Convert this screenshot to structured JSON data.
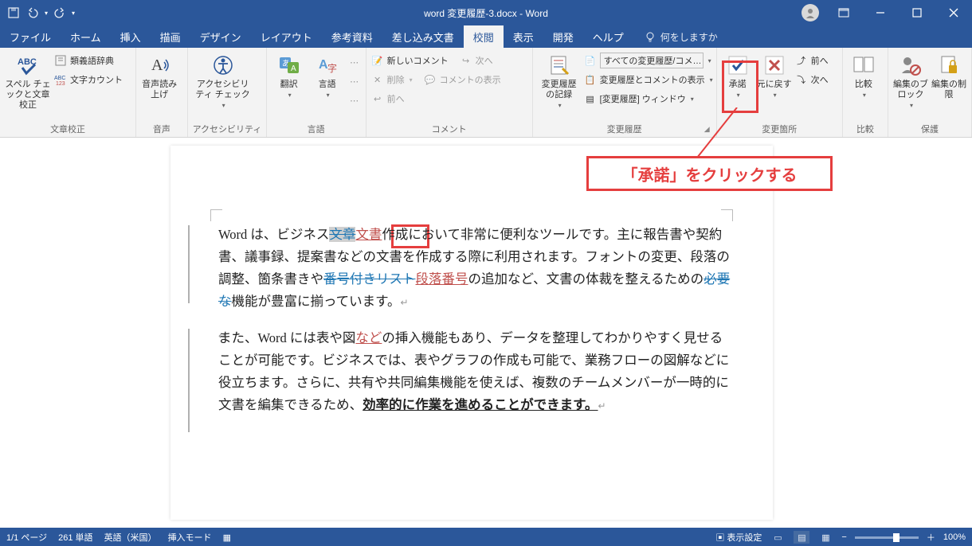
{
  "title": "word 変更履歴-3.docx  -  Word",
  "tabs": [
    "ファイル",
    "ホーム",
    "挿入",
    "描画",
    "デザイン",
    "レイアウト",
    "参考資料",
    "差し込み文書",
    "校閲",
    "表示",
    "開発",
    "ヘルプ"
  ],
  "active_tab": "校閲",
  "tell_me": "何をしますか",
  "groups": {
    "proofing": {
      "label": "文章校正",
      "spell": "スペル チェックと文章校正",
      "thesaurus": "類義語辞典",
      "wordcount": "文字カウント"
    },
    "speech": {
      "label": "音声",
      "readaloud": "音声読み上げ"
    },
    "accessibility": {
      "label": "アクセシビリティ",
      "check": "アクセシビリティ チェック"
    },
    "language": {
      "label": "言語",
      "translate": "翻訳",
      "language": "言語"
    },
    "comments": {
      "label": "コメント",
      "new": "新しいコメント",
      "delete": "削除",
      "prev": "前へ",
      "next": "次へ",
      "show": "コメントの表示"
    },
    "tracking": {
      "label": "変更履歴",
      "track": "変更履歴の記録",
      "display": "すべての変更履歴/コメ…",
      "showmarkup": "変更履歴とコメントの表示",
      "pane": "[変更履歴] ウィンドウ"
    },
    "changes": {
      "label": "変更箇所",
      "accept": "承諾",
      "reject": "元に戻す",
      "prev": "前へ",
      "next": "次へ"
    },
    "compare": {
      "label": "比較",
      "compare": "比較"
    },
    "protect": {
      "label": "保護",
      "block": "編集のブロック",
      "restrict": "編集の制限"
    }
  },
  "document": {
    "p1_a": "Word は、ビジネス",
    "p1_del1": "文章",
    "p1_ins1": "文書",
    "p1_b": "作成において非常に便利なツールです。主に報告書や契約書、議事録、提案書などの文書を作成する際に利用されます。フォントの変更、段落の調整、箇条書きや",
    "p1_del2": "番号付きリスト",
    "p1_ins2": "段落番号",
    "p1_c": "の追加など、文書の体裁を整えるための",
    "p1_del3": "必要な",
    "p1_d": "機能が豊富に揃っています。",
    "p2_a": "また、Word には表や図",
    "p2_ins1": "など",
    "p2_b": "の挿入機能もあり、データを整理してわかりやすく見せることが可能です。ビジネスでは、表やグラフの作成も可能で、業務フローの図解などに役立ちます。さらに、共有や共同編集機能を使えば、複数のチームメンバーが一時的に文書を編集できるため、",
    "p2_bold": "効率的に作業を進めることができます。"
  },
  "callout": "「承諾」をクリックする",
  "status": {
    "page": "1/1 ページ",
    "words": "261 単語",
    "lang": "英語（米国）",
    "mode": "挿入モード",
    "display": "表示設定",
    "zoom": "100%"
  }
}
